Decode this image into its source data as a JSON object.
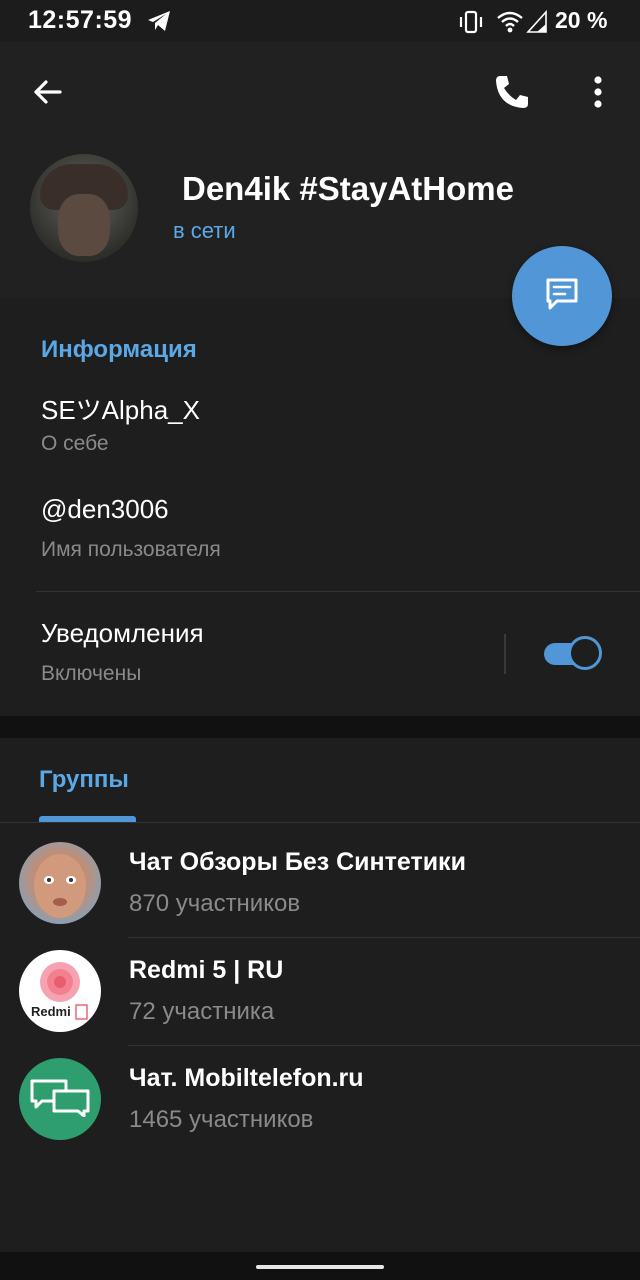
{
  "status_bar": {
    "time": "12:57:59",
    "battery": "20 %",
    "icons": [
      "telegram-icon",
      "vibrate-icon",
      "wifi-icon",
      "signal-icon"
    ]
  },
  "header": {
    "back_icon": "arrow-left-icon",
    "call_icon": "phone-icon",
    "more_icon": "more-vertical-icon",
    "name": "Den4ik #StayAtHome",
    "status": "в сети",
    "fab_icon": "message-icon"
  },
  "info": {
    "title": "Информация",
    "bio": "SEツAlpha_X",
    "bio_label": "О себе",
    "username": "@den3006",
    "username_label": "Имя пользователя",
    "notifications": "Уведомления",
    "notifications_state": "Включены",
    "notifications_on": true
  },
  "groups": {
    "tab": "Группы",
    "items": [
      {
        "name": "Чат Обзоры Без Синтетики",
        "count": "870 участников"
      },
      {
        "name": "Redmi 5 | RU",
        "count": "72 участника",
        "logo_text": "Redmi"
      },
      {
        "name": "Чат. Mobiltelefon.ru",
        "count": "1465 участников"
      }
    ]
  },
  "colors": {
    "accent": "#5196d6",
    "accent_text": "#5ba8e6",
    "background": "#1e1e1e",
    "header": "#212121",
    "group3_avatar": "#2e9e6e"
  }
}
